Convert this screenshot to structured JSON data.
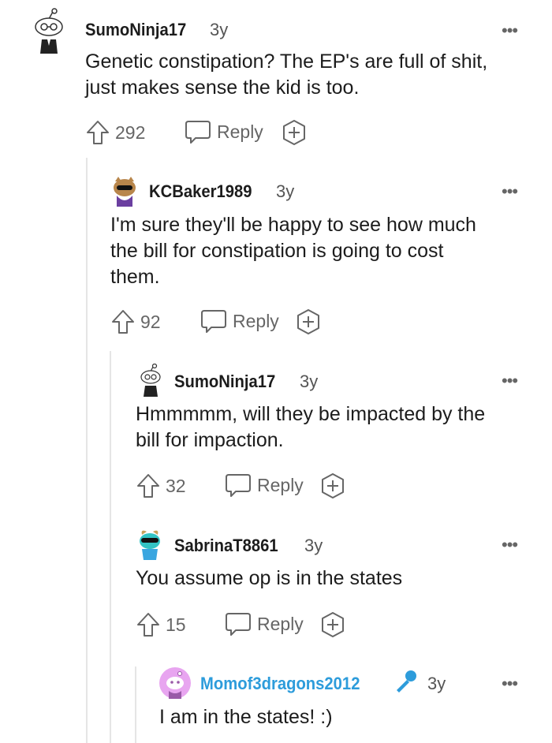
{
  "comments": [
    {
      "username": "SumoNinja17",
      "time": "3y",
      "text": "Genetic constipation? The EP's are full of shit,\njust makes sense the kid is too.",
      "votes": "292",
      "reply_label": "Reply"
    },
    {
      "username": "KCBaker1989",
      "time": "3y",
      "text": "I'm sure they'll be happy to see how much\nthe bill for constipation is going to cost\nthem.",
      "votes": "92",
      "reply_label": "Reply"
    },
    {
      "username": "SumoNinja17",
      "time": "3y",
      "text": "Hmmmmm, will they be impacted by the\nbill for impaction.",
      "votes": "32",
      "reply_label": "Reply"
    },
    {
      "username": "SabrinaT8861",
      "time": "3y",
      "text": "You assume op is in the states",
      "votes": "15",
      "reply_label": "Reply"
    },
    {
      "username": "Momof3dragons2012",
      "time": "3y",
      "text": "I am in the states! :)"
    }
  ],
  "more_glyph": "•••",
  "colors": {
    "op_username": "#2d9cdb",
    "muted": "#666666",
    "thread_line": "#e5e5e5"
  }
}
